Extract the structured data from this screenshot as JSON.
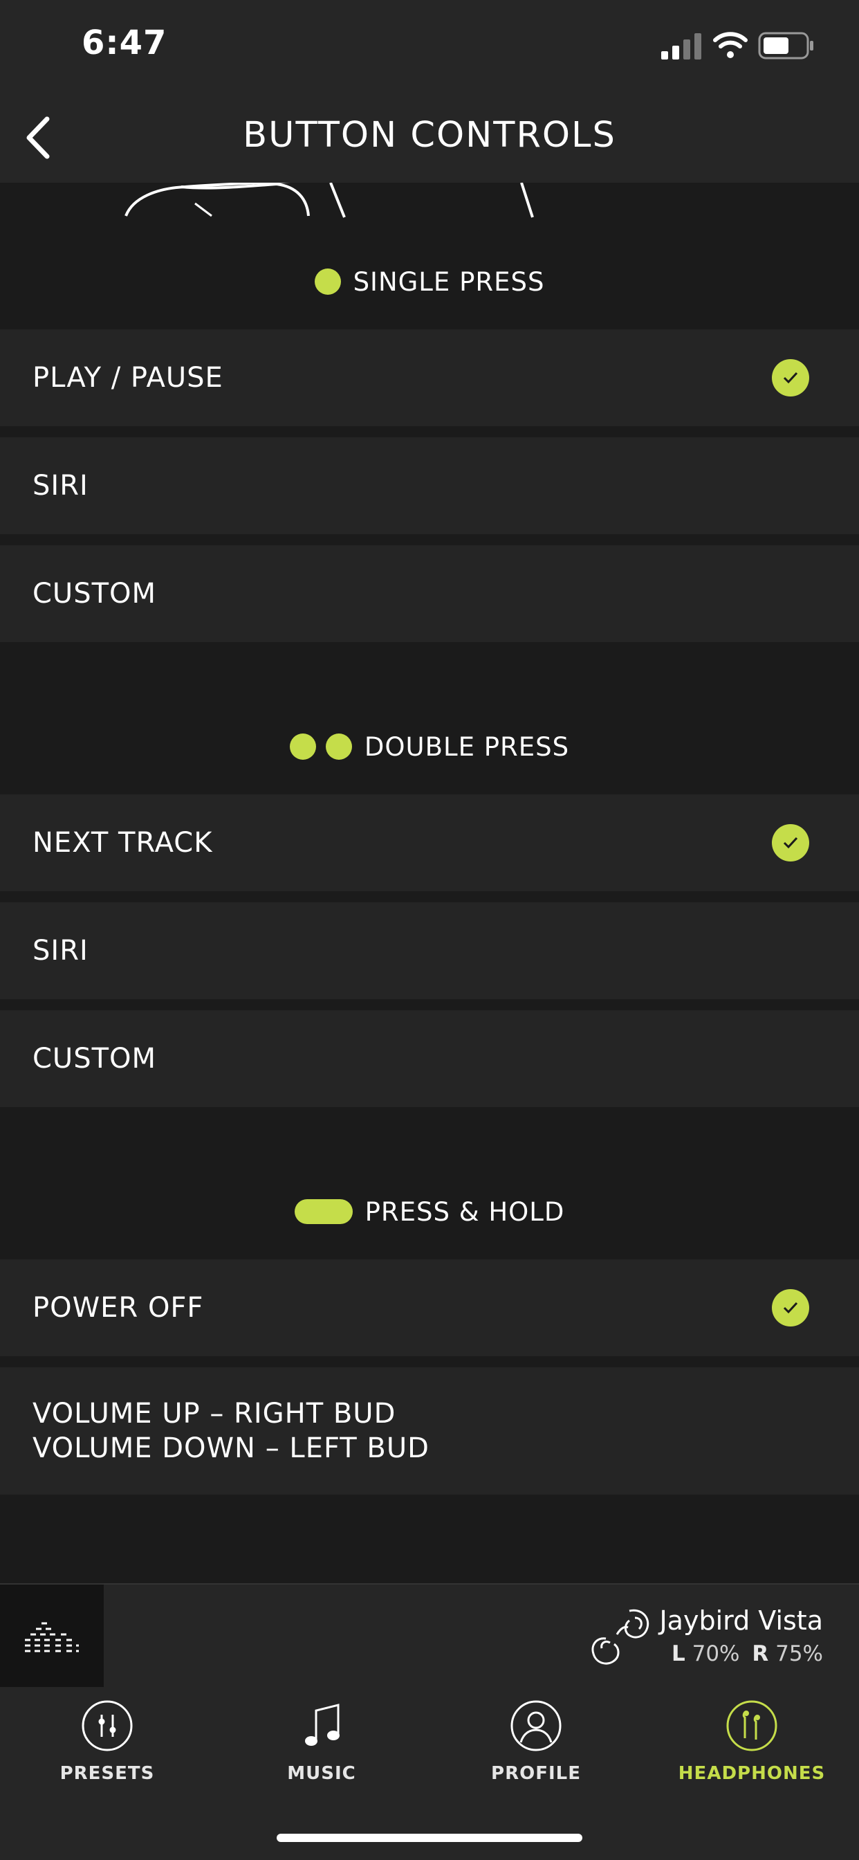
{
  "status": {
    "time": "6:47"
  },
  "header": {
    "title": "BUTTON CONTROLS"
  },
  "sections": {
    "single": {
      "title": "SINGLE PRESS",
      "options": [
        {
          "label": "PLAY / PAUSE",
          "selected": true
        },
        {
          "label": "SIRI",
          "selected": false
        },
        {
          "label": "CUSTOM",
          "selected": false
        }
      ]
    },
    "double": {
      "title": "DOUBLE PRESS",
      "options": [
        {
          "label": "NEXT TRACK",
          "selected": true
        },
        {
          "label": "SIRI",
          "selected": false
        },
        {
          "label": "CUSTOM",
          "selected": false
        }
      ]
    },
    "hold": {
      "title": "PRESS & HOLD",
      "options": [
        {
          "label": "POWER OFF",
          "selected": true
        },
        {
          "label_line1": "VOLUME UP – RIGHT BUD",
          "label_line2": "VOLUME DOWN – LEFT BUD",
          "selected": false
        }
      ]
    }
  },
  "player": {
    "device_name": "Jaybird Vista",
    "left_label": "L",
    "left_battery": "70%",
    "right_label": "R",
    "right_battery": "75%"
  },
  "tabs": [
    {
      "label": "PRESETS",
      "icon": "sliders-icon",
      "active": false
    },
    {
      "label": "MUSIC",
      "icon": "music-note-icon",
      "active": false
    },
    {
      "label": "PROFILE",
      "icon": "profile-icon",
      "active": false
    },
    {
      "label": "HEADPHONES",
      "icon": "headphones-icon",
      "active": true
    }
  ],
  "colors": {
    "accent": "#c5dd4a",
    "background": "#1b1b1b",
    "row": "#252525",
    "bar": "#262626"
  }
}
